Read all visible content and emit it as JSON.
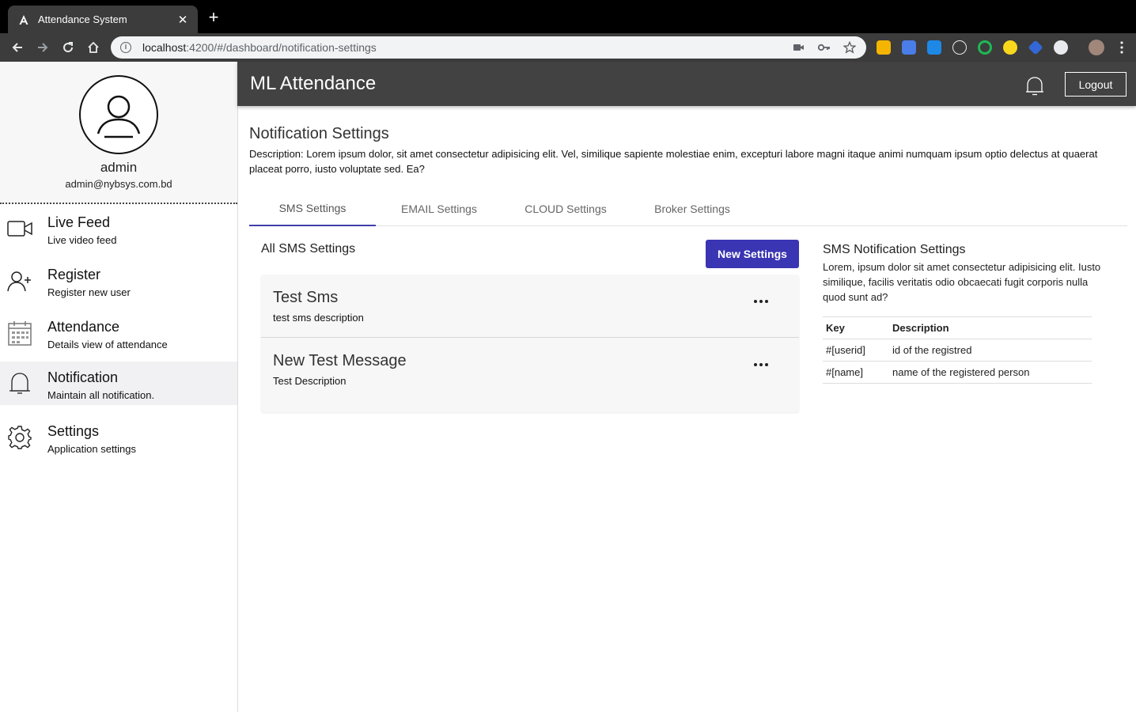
{
  "browser": {
    "tab_title": "Attendance System",
    "url_host": "localhost",
    "url_path": ":4200/#/dashboard/notification-settings"
  },
  "sidebar": {
    "profile": {
      "name": "admin",
      "email": "admin@nybsys.com.bd"
    },
    "items": [
      {
        "icon": "video-camera-icon",
        "title": "Live Feed",
        "subtitle": "Live video feed"
      },
      {
        "icon": "add-user-icon",
        "title": "Register",
        "subtitle": "Register new user"
      },
      {
        "icon": "calendar-icon",
        "title": "Attendance",
        "subtitle": "Details view of attendance"
      },
      {
        "icon": "bell-icon",
        "title": "Notification",
        "subtitle": "Maintain all notification.",
        "active": true
      },
      {
        "icon": "gear-icon",
        "title": "Settings",
        "subtitle": "Application settings"
      }
    ]
  },
  "header": {
    "title": "ML Attendance",
    "logout_label": "Logout"
  },
  "main": {
    "title": "Notification Settings",
    "description": "Description: Lorem ipsum dolor, sit amet consectetur adipisicing elit. Vel, similique sapiente molestiae enim, excepturi labore magni itaque animi numquam ipsum optio delectus at quaerat placeat porro, iusto voluptate sed. Ea?",
    "tabs": [
      {
        "label": "SMS Settings",
        "active": true
      },
      {
        "label": "EMAIL Settings"
      },
      {
        "label": "CLOUD Settings"
      },
      {
        "label": "Broker Settings"
      }
    ],
    "list_title": "All SMS Settings",
    "new_button_label": "New Settings",
    "items": [
      {
        "title": "Test Sms",
        "description": "test sms description"
      },
      {
        "title": "New Test Message",
        "description": "Test Description"
      }
    ],
    "info": {
      "title": "SMS Notification Settings",
      "description": "Lorem, ipsum dolor sit amet consectetur adipisicing elit. Iusto similique, facilis veritatis odio obcaecati fugit corporis nulla quod sunt ad?",
      "columns": [
        "Key",
        "Description"
      ],
      "rows": [
        [
          "#[userid]",
          "id of the registred"
        ],
        [
          "#[name]",
          "name of the registered person"
        ]
      ]
    }
  },
  "colors": {
    "accent": "#3a35b2",
    "header_bg": "#424242",
    "active_menu_bg": "#f1f1f3"
  }
}
